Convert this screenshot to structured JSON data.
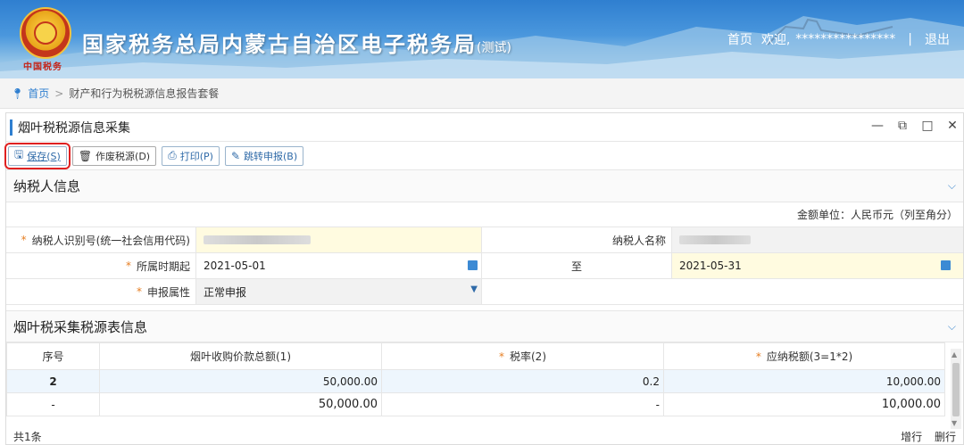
{
  "header": {
    "title": "国家税务总局内蒙古自治区电子税务局",
    "title_suffix": "(测试)",
    "emblem_text": "中国税务",
    "nav_home": "首页",
    "nav_welcome": "欢迎,",
    "nav_user": "****************",
    "nav_sep": "|",
    "nav_logout": "退出"
  },
  "breadcrumb": {
    "home": "首页",
    "arrow": ">",
    "current": "财产和行为税税源信息报告套餐"
  },
  "panel": {
    "title": "烟叶税税源信息采集",
    "controls": {
      "minimize": "—",
      "restore": "⧉",
      "maximize": "□",
      "close": "✕"
    }
  },
  "toolbar": {
    "save": "保存(S)",
    "void": "作废税源(D)",
    "print": "打印(P)",
    "goto": "跳转申报(B)"
  },
  "taxpayer_section": {
    "title": "纳税人信息",
    "unit": "金额单位：人民币元（列至角分）",
    "id_label": "纳税人识别号(统一社会信用代码)",
    "name_label": "纳税人名称",
    "period_label": "所属时期起",
    "period_start": "2021-05-01",
    "to_label": "至",
    "period_end": "2021-05-31",
    "attr_label": "申报属性",
    "attr_value": "正常申报",
    "req_mark": "*"
  },
  "collect_section": {
    "title": "烟叶税采集税源表信息",
    "columns": [
      "序号",
      "烟叶收购价款总额(1)",
      "税率(2)",
      "应纳税额(3=1*2)"
    ],
    "rows": [
      [
        "2",
        "50,000.00",
        "0.2",
        "10,000.00"
      ],
      [
        "-",
        "50,000.00",
        "-",
        "10,000.00"
      ]
    ],
    "total_label": "共1条",
    "add_row": "增行",
    "del_row": "删行"
  },
  "colors": {
    "accent": "#2f7fd0",
    "required": "#e67e22",
    "highlight": "#e02020"
  }
}
